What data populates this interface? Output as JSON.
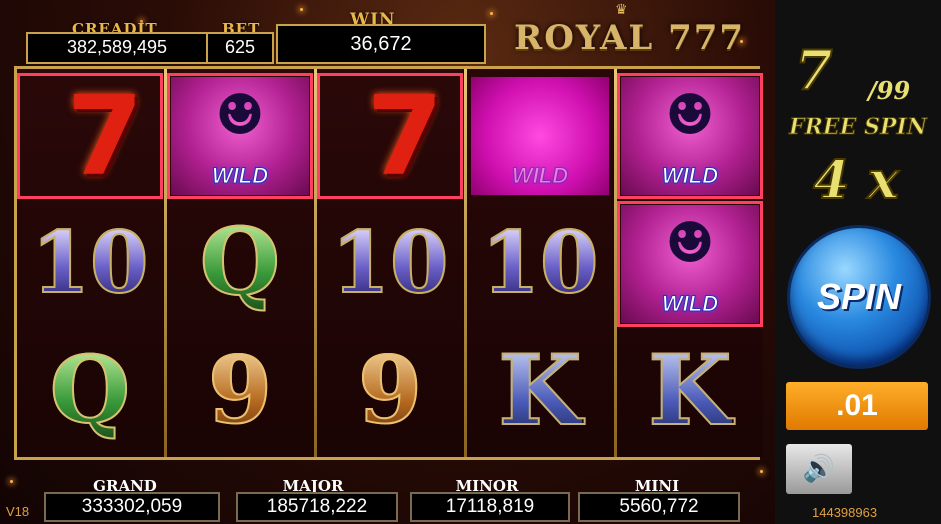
{
  "meters": {
    "credit_label": "CREADIT",
    "credit_value": "382,589,495",
    "bet_label": "BET",
    "bet_value": "625",
    "win_label": "WIN",
    "win_value": "36,672"
  },
  "logo": "ROYAL 777",
  "reels": [
    [
      "7",
      "10",
      "Q"
    ],
    [
      "WILD",
      "Q",
      "9"
    ],
    [
      "7",
      "10",
      "9"
    ],
    [
      "WILD",
      "10",
      "K"
    ],
    [
      "WILD",
      "WILD",
      "K"
    ]
  ],
  "wild_text": "WILD",
  "jackpots": [
    {
      "label": "GRAND",
      "value": "333302,059"
    },
    {
      "label": "MAJOR",
      "value": "185718,222"
    },
    {
      "label": "MINOR",
      "value": "17118,819"
    },
    {
      "label": "MINI",
      "value": "5560,772"
    }
  ],
  "version": "V18",
  "free_spin": {
    "current": "7",
    "total": "/99",
    "label": "FREE SPIN",
    "multiplier": "4 x"
  },
  "spin_label": "SPIN",
  "bet_level": ".01",
  "session_id": "144398963",
  "colors": {
    "gold": "#c9a24a",
    "highlight": "#ff4060",
    "spin_blue": "#2a8ae0",
    "bet_orange": "#ffae2a"
  }
}
